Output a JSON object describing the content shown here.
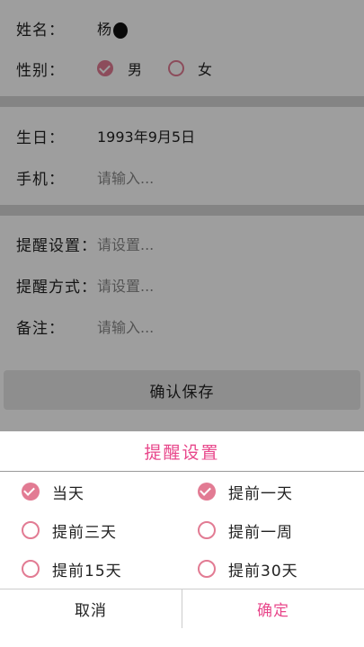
{
  "form": {
    "name": {
      "label": "姓名：",
      "value": "杨"
    },
    "gender": {
      "label": "性别：",
      "male": "男",
      "female": "女"
    },
    "birthday": {
      "label": "生日：",
      "value": "1993年9月5日"
    },
    "phone": {
      "label": "手机：",
      "placeholder": "请输入..."
    },
    "reminder_setting": {
      "label": "提醒设置：",
      "placeholder": "请设置..."
    },
    "reminder_method": {
      "label": "提醒方式：",
      "placeholder": "请设置..."
    },
    "note": {
      "label": "备注：",
      "placeholder": "请输入..."
    },
    "save_button": "确认保存"
  },
  "dialog": {
    "title": "提醒设置",
    "options": [
      {
        "label": "当天",
        "checked": true
      },
      {
        "label": "提前一天",
        "checked": true
      },
      {
        "label": "提前三天",
        "checked": false
      },
      {
        "label": "提前一周",
        "checked": false
      },
      {
        "label": "提前15天",
        "checked": false
      },
      {
        "label": "提前30天",
        "checked": false
      }
    ],
    "cancel": "取消",
    "confirm": "确定"
  },
  "colors": {
    "accent": "#e8478b",
    "radio": "#e27b93"
  }
}
